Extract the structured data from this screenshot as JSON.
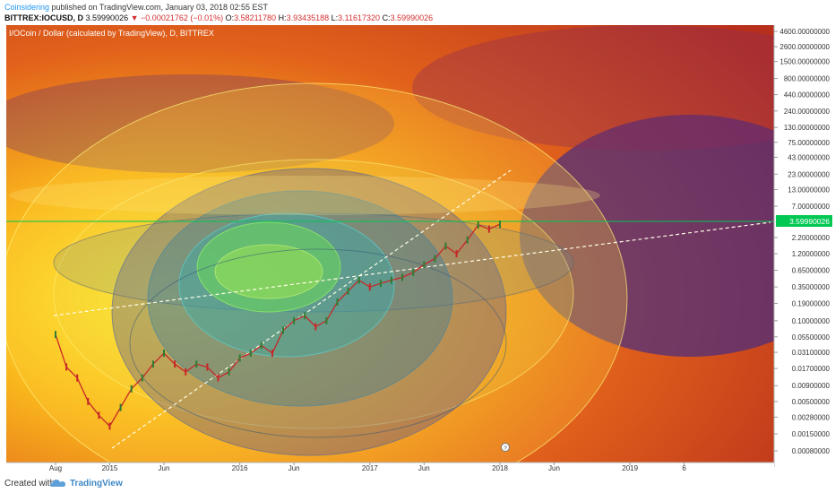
{
  "header": {
    "author": "Coinsidering",
    "published": "published on TradingView.com, January 03, 2018 02:55 EST",
    "symbol": "BITTREX:IOCUSD, D",
    "price": "3.59990026",
    "change": "−0.00021762 (−0.01%)",
    "o_label": "O:",
    "o": "3.58211780",
    "h_label": "H:",
    "h": "3.93435188",
    "l_label": "L:",
    "l": "3.11617320",
    "c_label": "C:",
    "c": "3.59990026"
  },
  "footer": {
    "created": "Created with",
    "brand": "TradingView"
  },
  "colors": {
    "accent": "#2196f3",
    "down": "#d32f2f",
    "last_price": "#00c853",
    "brand": "#3f87c5"
  },
  "chart_data": {
    "type": "line",
    "title": "I/OCoin / Dollar (calculated by TradingView), D, BITTREX",
    "y_scale": "log",
    "y_ticks": [
      "4600.00000000",
      "2600.00000000",
      "1500.00000000",
      "800.00000000",
      "440.00000000",
      "240.00000000",
      "130.00000000",
      "75.00000000",
      "43.00000000",
      "23.00000000",
      "13.00000000",
      "7.00000000",
      "2.20000000",
      "1.20000000",
      "0.65000000",
      "0.35000000",
      "0.19000000",
      "0.10000000",
      "0.05500000",
      "0.03100000",
      "0.01700000",
      "0.00900000",
      "0.00500000",
      "0.00280000",
      "0.00150000",
      "0.00080000"
    ],
    "x_ticks": [
      "Aug",
      "2015",
      "Jun",
      "2016",
      "Jun",
      "2017",
      "Jun",
      "2018",
      "Jun",
      "2019",
      "6"
    ],
    "last_price_label": "3.59990026",
    "grid": false,
    "x": [
      "2014-08",
      "2014-09",
      "2014-10",
      "2014-11",
      "2014-12",
      "2015-01",
      "2015-02",
      "2015-03",
      "2015-04",
      "2015-05",
      "2015-06",
      "2015-07",
      "2015-08",
      "2015-09",
      "2015-10",
      "2015-11",
      "2015-12",
      "2016-01",
      "2016-02",
      "2016-03",
      "2016-04",
      "2016-05",
      "2016-06",
      "2016-07",
      "2016-08",
      "2016-09",
      "2016-10",
      "2016-11",
      "2016-12",
      "2017-01",
      "2017-02",
      "2017-03",
      "2017-04",
      "2017-05",
      "2017-06",
      "2017-07",
      "2017-08",
      "2017-09",
      "2017-10",
      "2017-11",
      "2017-12",
      "2018-01"
    ],
    "series": [
      {
        "values": [
          0.06,
          0.018,
          0.012,
          0.005,
          0.003,
          0.002,
          0.004,
          0.008,
          0.012,
          0.02,
          0.03,
          0.02,
          0.015,
          0.02,
          0.018,
          0.012,
          0.015,
          0.025,
          0.03,
          0.04,
          0.03,
          0.07,
          0.1,
          0.12,
          0.08,
          0.1,
          0.2,
          0.3,
          0.45,
          0.35,
          0.4,
          0.45,
          0.5,
          0.6,
          0.8,
          1.0,
          1.6,
          1.2,
          2.0,
          3.5,
          3.0,
          3.6
        ]
      }
    ]
  }
}
